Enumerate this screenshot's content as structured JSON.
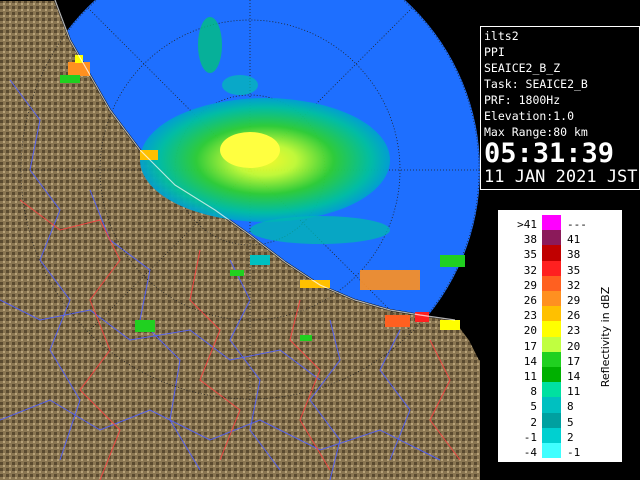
{
  "info": {
    "radar": "ilts2",
    "mode": "PPI",
    "product": "SEAICE2_B_Z",
    "task": "Task: SEAICE2_B",
    "prf": "PRF: 1800Hz",
    "elevation": "Elevation:1.0",
    "max_range": "Max Range:80 km",
    "time": "05:31:39",
    "date": "11 JAN 2021 JST"
  },
  "legend": {
    "title": "Reflectivity in dBZ",
    "rows": [
      {
        "lo": ">41",
        "hi": "---",
        "color": "#ff00ff"
      },
      {
        "lo": "38",
        "hi": "41",
        "color": "#8b1a5a"
      },
      {
        "lo": "35",
        "hi": "38",
        "color": "#c00000"
      },
      {
        "lo": "32",
        "hi": "35",
        "color": "#ff2020"
      },
      {
        "lo": "29",
        "hi": "32",
        "color": "#ff6020"
      },
      {
        "lo": "26",
        "hi": "29",
        "color": "#ff9020"
      },
      {
        "lo": "23",
        "hi": "26",
        "color": "#ffc000"
      },
      {
        "lo": "20",
        "hi": "23",
        "color": "#ffff00"
      },
      {
        "lo": "17",
        "hi": "20",
        "color": "#c0ff40"
      },
      {
        "lo": "14",
        "hi": "17",
        "color": "#20d020"
      },
      {
        "lo": "11",
        "hi": "14",
        "color": "#00b000"
      },
      {
        "lo": "8",
        "hi": "11",
        "color": "#00e0a0"
      },
      {
        "lo": "5",
        "hi": "8",
        "color": "#00c0c0"
      },
      {
        "lo": "2",
        "hi": "5",
        "color": "#00a0a0"
      },
      {
        "lo": "-1",
        "hi": "2",
        "color": "#00d0d0"
      },
      {
        "lo": "-4",
        "hi": "-1",
        "color": "#40ffff"
      }
    ]
  },
  "colors": {
    "coverage": "#1e6fff",
    "land": "#8a7652",
    "river": "#5060ff",
    "border": "#ff4040"
  }
}
